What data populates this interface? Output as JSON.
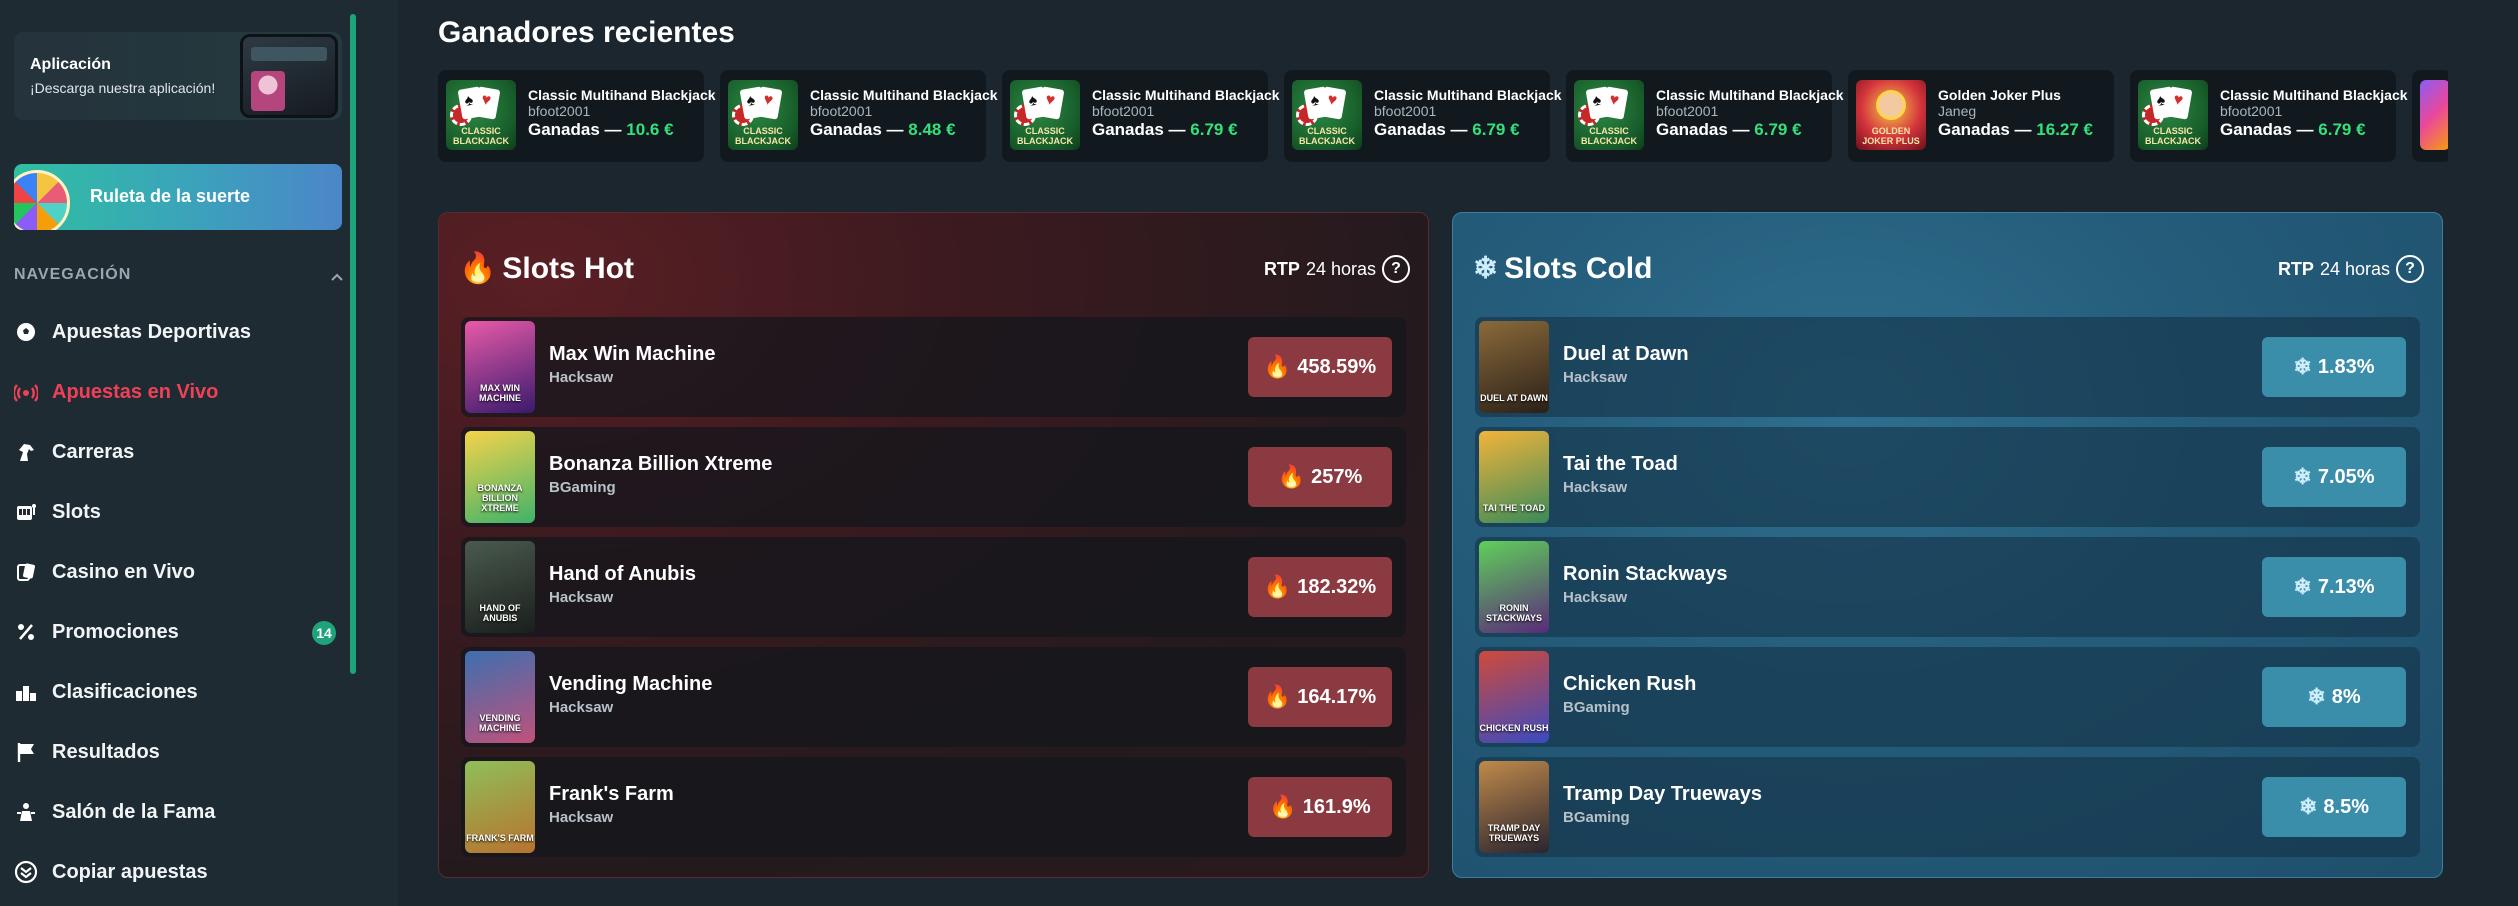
{
  "sidebar": {
    "app_card": {
      "title": "Aplicación",
      "subtitle": "¡Descarga nuestra aplicación!"
    },
    "fortune_label": "Ruleta de la suerte",
    "nav_title": "NAVEGACIÓN",
    "items": [
      {
        "label": "Apuestas Deportivas",
        "icon": "soccer-ball-icon"
      },
      {
        "label": "Apuestas en Vivo",
        "icon": "live-broadcast-icon",
        "active": true
      },
      {
        "label": "Carreras",
        "icon": "horse-icon"
      },
      {
        "label": "Slots",
        "icon": "slot-machine-icon"
      },
      {
        "label": "Casino en Vivo",
        "icon": "cards-icon"
      },
      {
        "label": "Promociones",
        "icon": "percent-icon",
        "badge": "14"
      },
      {
        "label": "Clasificaciones",
        "icon": "leaderboard-icon"
      },
      {
        "label": "Resultados",
        "icon": "flag-icon"
      },
      {
        "label": "Salón de la Fama",
        "icon": "trophy-person-icon"
      },
      {
        "label": "Copiar apuestas",
        "icon": "copy-bets-icon"
      }
    ]
  },
  "winners": {
    "title": "Ganadores recientes",
    "prefix": "Ganadas —",
    "items": [
      {
        "game": "Classic Multihand Blackjack",
        "user": "bfoot2001",
        "amount": "10.6 €",
        "thumb_label": "CLASSIC BLACKJACK"
      },
      {
        "game": "Classic Multihand Blackjack",
        "user": "bfoot2001",
        "amount": "8.48 €",
        "thumb_label": "CLASSIC BLACKJACK"
      },
      {
        "game": "Classic Multihand Blackjack",
        "user": "bfoot2001",
        "amount": "6.79 €",
        "thumb_label": "CLASSIC BLACKJACK"
      },
      {
        "game": "Classic Multihand Blackjack",
        "user": "bfoot2001",
        "amount": "6.79 €",
        "thumb_label": "CLASSIC BLACKJACK"
      },
      {
        "game": "Classic Multihand Blackjack",
        "user": "bfoot2001",
        "amount": "6.79 €",
        "thumb_label": "CLASSIC BLACKJACK"
      },
      {
        "game": "Golden Joker Plus",
        "user": "Janeg",
        "amount": "16.27 €",
        "thumb_label": "GOLDEN JOKER PLUS"
      },
      {
        "game": "Classic Multihand Blackjack",
        "user": "bfoot2001",
        "amount": "6.79 €",
        "thumb_label": "CLASSIC BLACKJACK"
      }
    ]
  },
  "hot": {
    "title": "Slots Hot",
    "rtp_label": "RTP",
    "rtp_period": "24 horas",
    "games": [
      {
        "name": "Max Win Machine",
        "provider": "Hacksaw",
        "rtp": "458.59%",
        "thumb_label": "MAX WIN MACHINE",
        "c1": "#e85aa8",
        "c2": "#3a1a6e"
      },
      {
        "name": "Bonanza Billion Xtreme",
        "provider": "BGaming",
        "rtp": "257%",
        "thumb_label": "BONANZA BILLION XTREME",
        "c1": "#f5d34a",
        "c2": "#3fb36a"
      },
      {
        "name": "Hand of Anubis",
        "provider": "Hacksaw",
        "rtp": "182.32%",
        "thumb_label": "HAND OF ANUBIS",
        "c1": "#4a5a4e",
        "c2": "#1a1f1c"
      },
      {
        "name": "Vending Machine",
        "provider": "Hacksaw",
        "rtp": "164.17%",
        "thumb_label": "VENDING MACHINE",
        "c1": "#3d6fb0",
        "c2": "#c0527a"
      },
      {
        "name": "Frank's Farm",
        "provider": "Hacksaw",
        "rtp": "161.9%",
        "thumb_label": "FRANK'S FARM",
        "c1": "#8fbf5a",
        "c2": "#b8722e"
      }
    ]
  },
  "cold": {
    "title": "Slots Cold",
    "rtp_label": "RTP",
    "rtp_period": "24 horas",
    "games": [
      {
        "name": "Duel at Dawn",
        "provider": "Hacksaw",
        "rtp": "1.83%",
        "thumb_label": "DUEL AT DAWN",
        "c1": "#8a6a3a",
        "c2": "#2a2018"
      },
      {
        "name": "Tai the Toad",
        "provider": "Hacksaw",
        "rtp": "7.05%",
        "thumb_label": "TAI THE TOAD",
        "c1": "#f2b43a",
        "c2": "#3a8a5a"
      },
      {
        "name": "Ronin Stackways",
        "provider": "Hacksaw",
        "rtp": "7.13%",
        "thumb_label": "RONIN STACKWAYS",
        "c1": "#5fd05a",
        "c2": "#5a2a7a"
      },
      {
        "name": "Chicken Rush",
        "provider": "BGaming",
        "rtp": "8%",
        "thumb_label": "CHICKEN RUSH",
        "c1": "#d04a3a",
        "c2": "#3a4ac0"
      },
      {
        "name": "Tramp Day Trueways",
        "provider": "BGaming",
        "rtp": "8.5%",
        "thumb_label": "TRAMP DAY TRUEWAYS",
        "c1": "#c08a4a",
        "c2": "#2a2430"
      }
    ]
  },
  "colors": {
    "accent_green": "#1fa37a",
    "live_red": "#f04057",
    "win_green": "#34e07a"
  }
}
